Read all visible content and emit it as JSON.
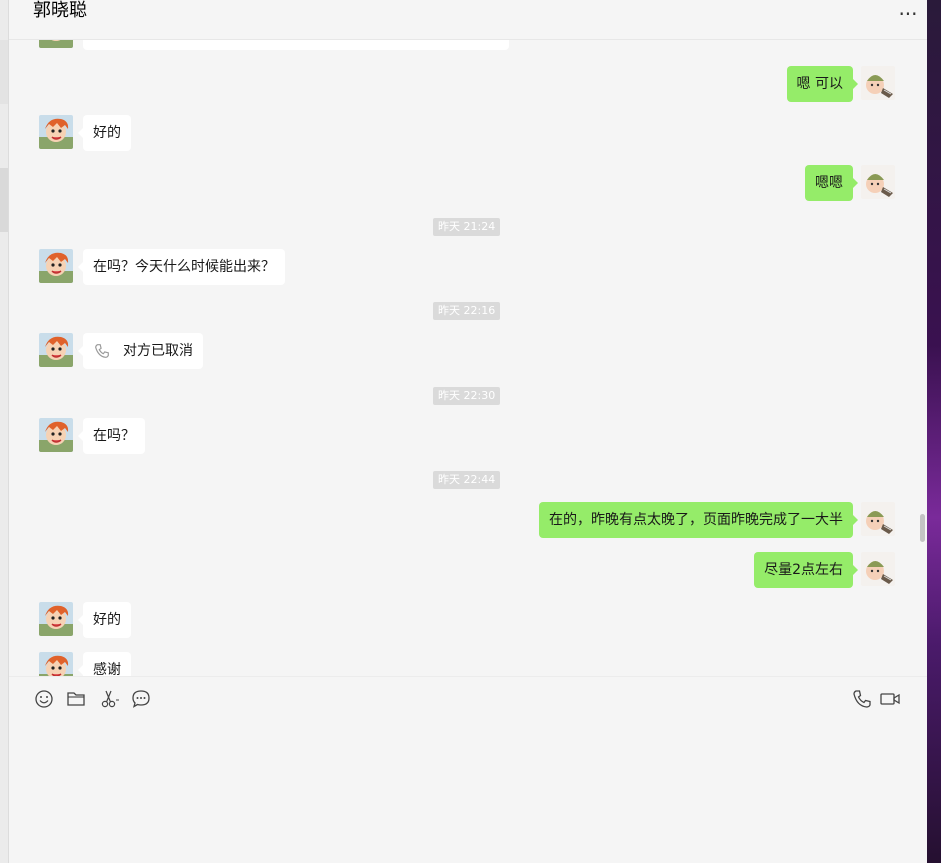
{
  "header": {
    "title": "郭晓聪",
    "more_icon": "more-dots-icon"
  },
  "messages": [
    {
      "id": "m1",
      "dir": "out",
      "text": "嗯  可以"
    },
    {
      "id": "m2",
      "dir": "in",
      "text": "好的"
    },
    {
      "id": "m3",
      "dir": "out",
      "text": "嗯嗯"
    },
    {
      "id": "t1",
      "type": "time",
      "text": "昨天 21:24"
    },
    {
      "id": "m4",
      "dir": "in",
      "text": "在吗？今天什么时候能出来？"
    },
    {
      "id": "t2",
      "type": "time",
      "text": "昨天 22:16"
    },
    {
      "id": "m5",
      "dir": "in",
      "type": "call",
      "text": "对方已取消",
      "icon": "phone-icon"
    },
    {
      "id": "t3",
      "type": "time",
      "text": "昨天 22:30"
    },
    {
      "id": "m6",
      "dir": "in",
      "text": "在吗？"
    },
    {
      "id": "t4",
      "type": "time",
      "text": "昨天 22:44"
    },
    {
      "id": "m7",
      "dir": "out",
      "text": "在的，昨晚有点太晚了，页面昨晚完成了一大半"
    },
    {
      "id": "m8",
      "dir": "out",
      "text": "尽量2点左右"
    },
    {
      "id": "m9",
      "dir": "in",
      "text": "好的"
    },
    {
      "id": "m10",
      "dir": "in",
      "text": "感谢"
    }
  ],
  "toolbar": {
    "left": [
      "emoji-icon",
      "folder-icon",
      "scissors-icon",
      "chat-history-icon"
    ],
    "right": [
      "voice-call-icon",
      "video-call-icon"
    ]
  },
  "colors": {
    "background": "#f5f5f5",
    "outgoing_bubble": "#95ec69",
    "incoming_bubble": "#ffffff",
    "timestamp_bg": "#dadada"
  }
}
